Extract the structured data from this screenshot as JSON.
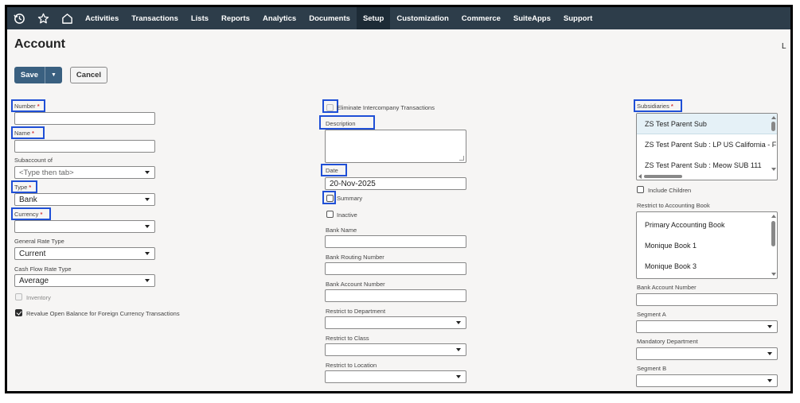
{
  "nav": {
    "icons": [
      "history-icon",
      "star-icon",
      "home-icon"
    ],
    "items": [
      "Activities",
      "Transactions",
      "Lists",
      "Reports",
      "Analytics",
      "Documents",
      "Setup",
      "Customization",
      "Commerce",
      "SuiteApps",
      "Support"
    ],
    "active": "Setup"
  },
  "page": {
    "title": "Account",
    "corner_letter": "L"
  },
  "toolbar": {
    "save_label": "Save",
    "cancel_label": "Cancel"
  },
  "left": {
    "number_label": "Number",
    "name_label": "Name",
    "subaccount_label": "Subaccount of",
    "subaccount_placeholder": "<Type then tab>",
    "type_label": "Type",
    "type_value": "Bank",
    "currency_label": "Currency",
    "currency_value": "",
    "general_rate_label": "General Rate Type",
    "general_rate_value": "Current",
    "cash_flow_label": "Cash Flow Rate Type",
    "cash_flow_value": "Average",
    "inventory_label": "Inventory",
    "revalue_label": "Revalue Open Balance for Foreign Currency Transactions"
  },
  "middle": {
    "eliminate_label": "Eliminate Intercompany Transactions",
    "description_label": "Description",
    "date_label": "Date",
    "date_value": "20-Nov-2025",
    "summary_label": "Summary",
    "inactive_label": "Inactive",
    "bank_name_label": "Bank Name",
    "bank_routing_label": "Bank Routing Number",
    "bank_account_label": "Bank Account Number",
    "restrict_department_label": "Restrict to Department",
    "restrict_class_label": "Restrict to Class",
    "restrict_location_label": "Restrict to Location"
  },
  "right": {
    "subsidiaries_label": "Subsidiaries",
    "subsidiaries": [
      "ZS Test Parent Sub",
      "ZS Test Parent Sub : LP US California - F",
      "ZS Test Parent Sub : Meow SUB 111"
    ],
    "include_children_label": "Include Children",
    "accounting_book_label": "Restrict to Accounting Book",
    "accounting_books": [
      "Primary Accounting Book",
      "Monique Book 1",
      "Monique Book 3"
    ],
    "bank_account_label": "Bank Account Number",
    "segment_a_label": "Segment A",
    "mandatory_department_label": "Mandatory Department",
    "segment_b_label": "Segment B"
  },
  "colors": {
    "nav_bg": "#2d3d4a",
    "save_bg": "#3a6080",
    "highlight_box": "#1f4fd6",
    "required": "#d43b3b"
  }
}
